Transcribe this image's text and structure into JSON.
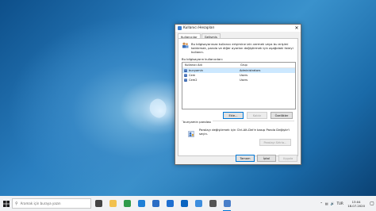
{
  "dialog": {
    "title": "Kullanıcı Hesapları",
    "close_glyph": "✕",
    "tabs": [
      "Kullanıcılar",
      "Gelişmiş"
    ],
    "intro_text": "Bu bilgisayarınıza kullanıcı erişimine izin vermek veya bu erişimi kaldırmak, parola ve diğer ayarları değiştirmek için aşağıdaki listeyi kullanın.",
    "users_label": "Bu bilgisayarın kullanıcıları:",
    "columns": {
      "name": "Kullanıcı Adı",
      "group": "Grup"
    },
    "rows": [
      {
        "name": "bunyamin",
        "group": "Administrators"
      },
      {
        "name": "Cem",
        "group": "Users"
      },
      {
        "name": "Cem2",
        "group": "Users"
      }
    ],
    "buttons": {
      "add": "Ekle...",
      "remove": "Kaldır",
      "properties": "Özellikler"
    },
    "password_group_title": "bunyamin parolası",
    "password_text": "Parolayı değiştirmek için Ctrl-Alt-Del'e basıp Parola Değiştir'i seçin.",
    "reset_password": "Parolayı Sıfırla...",
    "footer": {
      "ok": "Tamam",
      "cancel": "İptal",
      "apply": "Uygula"
    }
  },
  "taskbar": {
    "search_placeholder": "Aramak için buraya yazın",
    "apps": [
      {
        "icon": "task-view-icon",
        "color": "#444444"
      },
      {
        "icon": "file-explorer-icon",
        "color": "#f2c14e"
      },
      {
        "icon": "chrome-icon",
        "color": "#2f9b4a"
      },
      {
        "icon": "edge-icon",
        "color": "#1f7fd6"
      },
      {
        "icon": "store-icon",
        "color": "#2b6cc4"
      },
      {
        "icon": "mail-icon",
        "color": "#1f6fd0"
      },
      {
        "icon": "outlook-icon",
        "color": "#0a64c0"
      },
      {
        "icon": "control-panel-icon",
        "color": "#3e8ede"
      },
      {
        "icon": "settings-icon",
        "color": "#555555"
      },
      {
        "icon": "user-accounts-icon",
        "color": "#4a7fc9"
      }
    ],
    "tray": {
      "language": "TUR",
      "time": "13:04",
      "date": "18.07.2020"
    }
  },
  "colors": {
    "accent": "#0078d7",
    "selection": "#cce8ff"
  }
}
